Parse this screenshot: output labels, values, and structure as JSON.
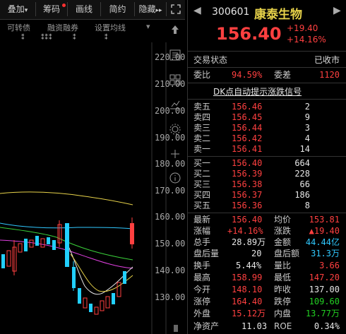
{
  "toolbar": {
    "items": [
      "叠加",
      "筹码",
      "画线",
      "简约",
      "隐藏"
    ],
    "more_icon": "double-chevron-right",
    "fullscreen_icon": "expand-arrows"
  },
  "subbar": {
    "items": [
      "可转债",
      "融资融券",
      "设置均线"
    ],
    "markers": [
      "⁑",
      "⁑⁑⁑",
      "⁑",
      "⁑"
    ]
  },
  "chart": {
    "y_labels": [
      "220.00",
      "210.00",
      "200.00",
      "190.00",
      "180.00",
      "170.00",
      "160.00",
      "150.00",
      "140.00",
      "130.00"
    ]
  },
  "quote": {
    "code": "300601",
    "name": "康泰生物",
    "price": "156.40",
    "change": "+19.40",
    "change_pct": "+14.16%",
    "status_label": "交易状态",
    "status_value": "已收市",
    "weibi_label": "委比",
    "weibi_value": "94.59%",
    "weicha_label": "委差",
    "weicha_value": "1120",
    "banner": "DK点自动提示涨跌信号"
  },
  "order_book": {
    "asks": [
      {
        "label": "卖五",
        "price": "156.46",
        "vol": "2"
      },
      {
        "label": "卖四",
        "price": "156.45",
        "vol": "9"
      },
      {
        "label": "卖三",
        "price": "156.44",
        "vol": "3"
      },
      {
        "label": "卖二",
        "price": "156.42",
        "vol": "4"
      },
      {
        "label": "卖一",
        "price": "156.41",
        "vol": "14"
      }
    ],
    "bids": [
      {
        "label": "买一",
        "price": "156.40",
        "vol": "664"
      },
      {
        "label": "买二",
        "price": "156.39",
        "vol": "228"
      },
      {
        "label": "买三",
        "price": "156.38",
        "vol": "66"
      },
      {
        "label": "买四",
        "price": "156.37",
        "vol": "186"
      },
      {
        "label": "买五",
        "price": "156.36",
        "vol": "8"
      }
    ]
  },
  "stats": {
    "rows": [
      [
        {
          "label": "最新",
          "value": "156.40"
        },
        {
          "label": "均价",
          "value": "153.81"
        }
      ],
      [
        {
          "label": "涨幅",
          "value": "+14.16%"
        },
        {
          "label": "涨跌",
          "value": "▲19.40"
        }
      ],
      [
        {
          "label": "总手",
          "value": "28.89万"
        },
        {
          "label": "金额",
          "value": "44.44亿"
        }
      ],
      [
        {
          "label": "盘后量",
          "value": "20"
        },
        {
          "label": "盘后额",
          "value": "31.3万"
        }
      ],
      [
        {
          "label": "换手",
          "value": "5.44%"
        },
        {
          "label": "量比",
          "value": "3.66"
        }
      ],
      [
        {
          "label": "最高",
          "value": "158.99"
        },
        {
          "label": "最低",
          "value": "147.20"
        }
      ],
      [
        {
          "label": "今开",
          "value": "148.10"
        },
        {
          "label": "昨收",
          "value": "137.00"
        }
      ],
      [
        {
          "label": "涨停",
          "value": "164.40"
        },
        {
          "label": "跌停",
          "value": "109.60"
        }
      ],
      [
        {
          "label": "外盘",
          "value": "15.12万"
        },
        {
          "label": "内盘",
          "value": "13.77万"
        }
      ],
      [
        {
          "label": "净资产",
          "value": "11.03"
        },
        {
          "label": "ROE",
          "value": "0.34%"
        }
      ]
    ]
  },
  "colors": {
    "up": "#ff4040",
    "down": "#22d022",
    "highlight": "#2fc9ff",
    "accent": "#e8d34a"
  }
}
